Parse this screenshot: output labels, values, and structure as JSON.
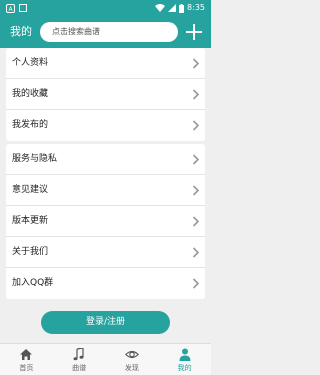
{
  "status_bar": {
    "time": "8:35",
    "icons": [
      "app-notification-icon",
      "square-notification-icon",
      "wifi-icon",
      "cellular-signal-icon",
      "battery-icon"
    ]
  },
  "header": {
    "title": "我的",
    "search_placeholder": "点击搜索曲谱",
    "add_icon": "plus-icon"
  },
  "menu": {
    "group1": [
      {
        "label": "个人资料"
      },
      {
        "label": "我的收藏"
      },
      {
        "label": "我发布的"
      }
    ],
    "group2": [
      {
        "label": "服务与隐私"
      },
      {
        "label": "意见建议"
      },
      {
        "label": "版本更新"
      },
      {
        "label": "关于我们"
      },
      {
        "label": "加入QQ群"
      }
    ]
  },
  "login_button": "登录/注册",
  "bottom_nav": [
    {
      "label": "首页",
      "icon": "home-icon",
      "active": false
    },
    {
      "label": "曲谱",
      "icon": "music-note-icon",
      "active": false
    },
    {
      "label": "发现",
      "icon": "eye-icon",
      "active": false
    },
    {
      "label": "我的",
      "icon": "person-icon",
      "active": true
    }
  ],
  "colors": {
    "accent": "#26a39e",
    "background": "#efefef"
  }
}
